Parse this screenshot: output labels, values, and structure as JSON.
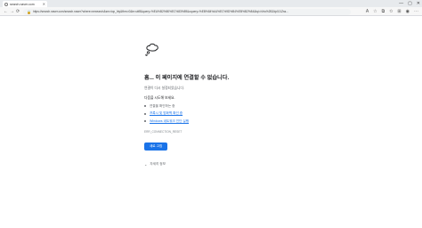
{
  "tab": {
    "title": "search.naver.com",
    "close_icon": "✕"
  },
  "window": {
    "minimize": "—",
    "maximize": "▢",
    "close": "✕"
  },
  "toolbar": {
    "back": "←",
    "forward": "→",
    "refresh": "⟳",
    "url": "https://search.naver.com/search.naver?where=nexearch&sm=top_hty&fbm=0&ie=utf8&query=%EA%B2%80%EC%83%89&oquery=%EB%84%A4%EC%9D%B4%EB%B2%84&tqi=hXw%2BZdp0J1Zss..."
  },
  "error": {
    "heading": "흠... 이 페이지에 연결할 수 없습니다.",
    "subtitle": "연결이 다시 설정되었습니다.",
    "try_title": "다음을 시도해 보세요.",
    "suggestions": [
      {
        "text": "연결을 확인하는 중",
        "link": false
      },
      {
        "text": "프록시 및 방화벽 확인 중",
        "link": true
      },
      {
        "text": "Windows 네트워크 진단 실행",
        "link": true
      }
    ],
    "error_code": "ERR_CONNECTION_RESET",
    "reload_label": "새로 고침",
    "details_label": "자세히 정보"
  }
}
